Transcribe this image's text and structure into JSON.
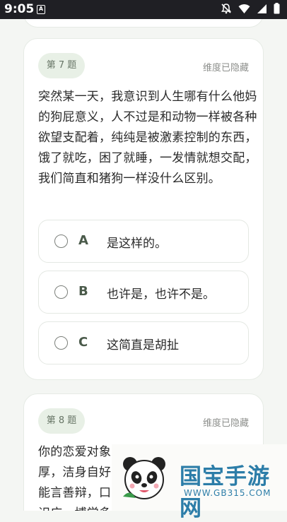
{
  "status_bar": {
    "time": "9:05",
    "app_icon_letter": "A"
  },
  "questions": [
    {
      "number_label": "第 7 题",
      "dimension_label": "维度已隐藏",
      "text": "突然某一天，我意识到人生哪有什么他妈的狗屁意义，人不过是和动物一样被各种欲望支配着，纯纯是被激素控制的东西，饿了就吃，困了就睡，一发情就想交配，我们简直和猪狗一样没什么区别。",
      "options": [
        {
          "letter": "A",
          "text": "是这样的。"
        },
        {
          "letter": "B",
          "text": "也许是，也许不是。"
        },
        {
          "letter": "C",
          "text": "这简直是胡扯"
        }
      ]
    },
    {
      "number_label": "第 8 题",
      "dimension_label": "维度已隐藏",
      "text": "你的恋爱对象\n厚，洁身自好\n能言善辩，口\n识广，博学多"
    }
  ],
  "watermark": {
    "brand": "国宝手游网",
    "url": "WWW.GB315.COM"
  },
  "colors": {
    "status_bar": "#1f1f24",
    "background": "#f4f6f3",
    "badge_bg": "#e8f0e6",
    "brand_blue": "#2c7da8"
  }
}
